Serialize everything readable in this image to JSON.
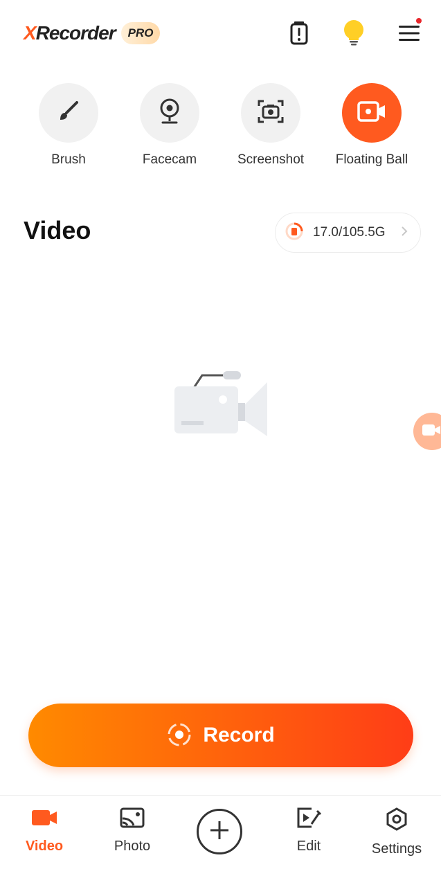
{
  "header": {
    "logo_x": "X",
    "logo_text": "Recorder",
    "pro_badge": "PRO",
    "icons": [
      "battery-alert-icon",
      "lightbulb-icon",
      "menu-icon"
    ],
    "menu_notification": true
  },
  "tools": [
    {
      "label": "Brush",
      "icon": "brush-icon",
      "active": false
    },
    {
      "label": "Facecam",
      "icon": "webcam-icon",
      "active": false
    },
    {
      "label": "Screenshot",
      "icon": "screenshot-camera-icon",
      "active": false
    },
    {
      "label": "Floating Ball",
      "icon": "video-camera-icon",
      "active": true
    }
  ],
  "video_section": {
    "title": "Video",
    "storage": "17.0/105.5G"
  },
  "empty_state": {
    "icon": "video-camera-placeholder-icon"
  },
  "record_button": {
    "label": "Record"
  },
  "bottom_nav": {
    "items": [
      {
        "label": "Video",
        "icon": "video-icon",
        "active": true
      },
      {
        "label": "Photo",
        "icon": "photo-icon",
        "active": false
      },
      {
        "label": "",
        "icon": "plus-icon",
        "active": false
      },
      {
        "label": "Edit",
        "icon": "edit-icon",
        "active": false
      },
      {
        "label": "Settings",
        "icon": "settings-hex-icon",
        "active": false
      }
    ]
  },
  "colors": {
    "accent": "#ff5a1f",
    "gradient_start": "#ff8a00",
    "gradient_end": "#ff3d17",
    "notification": "#e8262b",
    "tool_bg": "#f1f1f1"
  }
}
